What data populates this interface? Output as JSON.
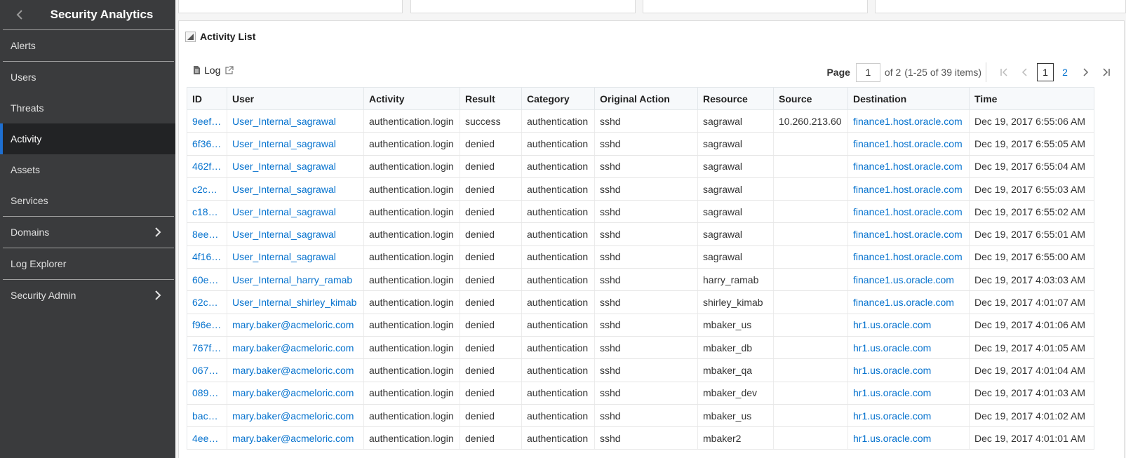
{
  "sidebar": {
    "title": "Security Analytics",
    "items": [
      {
        "label": "Alerts"
      },
      {
        "label": "Users"
      },
      {
        "label": "Threats"
      },
      {
        "label": "Activity"
      },
      {
        "label": "Assets"
      },
      {
        "label": "Services"
      },
      {
        "label": "Domains"
      },
      {
        "label": "Log Explorer"
      },
      {
        "label": "Security Admin"
      }
    ],
    "active": "Activity"
  },
  "panel": {
    "title": "Activity List",
    "log_label": "Log"
  },
  "pager": {
    "page_label": "Page",
    "current_page": "1",
    "of_text": "of 2",
    "range_text": "(1-25 of 39 items)",
    "pages": [
      "1",
      "2"
    ]
  },
  "table": {
    "columns": [
      "ID",
      "User",
      "Activity",
      "Result",
      "Category",
      "Original Action",
      "Resource",
      "Source",
      "Destination",
      "Time"
    ],
    "rows": [
      [
        "9eef…",
        "User_Internal_sagrawal",
        "authentication.login",
        "success",
        "authentication",
        "sshd",
        "sagrawal",
        "10.260.213.60",
        "finance1.host.oracle.com",
        "Dec 19, 2017 6:55:06 AM"
      ],
      [
        "6f36…",
        "User_Internal_sagrawal",
        "authentication.login",
        "denied",
        "authentication",
        "sshd",
        "sagrawal",
        "",
        "finance1.host.oracle.com",
        "Dec 19, 2017 6:55:05 AM"
      ],
      [
        "462f…",
        "User_Internal_sagrawal",
        "authentication.login",
        "denied",
        "authentication",
        "sshd",
        "sagrawal",
        "",
        "finance1.host.oracle.com",
        "Dec 19, 2017 6:55:04 AM"
      ],
      [
        "c2c…",
        "User_Internal_sagrawal",
        "authentication.login",
        "denied",
        "authentication",
        "sshd",
        "sagrawal",
        "",
        "finance1.host.oracle.com",
        "Dec 19, 2017 6:55:03 AM"
      ],
      [
        "c18…",
        "User_Internal_sagrawal",
        "authentication.login",
        "denied",
        "authentication",
        "sshd",
        "sagrawal",
        "",
        "finance1.host.oracle.com",
        "Dec 19, 2017 6:55:02 AM"
      ],
      [
        "8ee…",
        "User_Internal_sagrawal",
        "authentication.login",
        "denied",
        "authentication",
        "sshd",
        "sagrawal",
        "",
        "finance1.host.oracle.com",
        "Dec 19, 2017 6:55:01 AM"
      ],
      [
        "4f16…",
        "User_Internal_sagrawal",
        "authentication.login",
        "denied",
        "authentication",
        "sshd",
        "sagrawal",
        "",
        "finance1.host.oracle.com",
        "Dec 19, 2017 6:55:00 AM"
      ],
      [
        "60e…",
        "User_Internal_harry_ramab",
        "authentication.login",
        "denied",
        "authentication",
        "sshd",
        "harry_ramab",
        "",
        "finance1.us.oracle.com",
        "Dec 19, 2017 4:03:03 AM"
      ],
      [
        "62c…",
        "User_Internal_shirley_kimab",
        "authentication.login",
        "denied",
        "authentication",
        "sshd",
        "shirley_kimab",
        "",
        "finance1.us.oracle.com",
        "Dec 19, 2017 4:01:07 AM"
      ],
      [
        "f96e…",
        "mary.baker@acmeloric.com",
        "authentication.login",
        "denied",
        "authentication",
        "sshd",
        "mbaker_us",
        "",
        "hr1.us.oracle.com",
        "Dec 19, 2017 4:01:06 AM"
      ],
      [
        "767f…",
        "mary.baker@acmeloric.com",
        "authentication.login",
        "denied",
        "authentication",
        "sshd",
        "mbaker_db",
        "",
        "hr1.us.oracle.com",
        "Dec 19, 2017 4:01:05 AM"
      ],
      [
        "067…",
        "mary.baker@acmeloric.com",
        "authentication.login",
        "denied",
        "authentication",
        "sshd",
        "mbaker_qa",
        "",
        "hr1.us.oracle.com",
        "Dec 19, 2017 4:01:04 AM"
      ],
      [
        "089…",
        "mary.baker@acmeloric.com",
        "authentication.login",
        "denied",
        "authentication",
        "sshd",
        "mbaker_dev",
        "",
        "hr1.us.oracle.com",
        "Dec 19, 2017 4:01:03 AM"
      ],
      [
        "bac…",
        "mary.baker@acmeloric.com",
        "authentication.login",
        "denied",
        "authentication",
        "sshd",
        "mbaker_us",
        "",
        "hr1.us.oracle.com",
        "Dec 19, 2017 4:01:02 AM"
      ],
      [
        "4ee…",
        "mary.baker@acmeloric.com",
        "authentication.login",
        "denied",
        "authentication",
        "sshd",
        "mbaker2",
        "",
        "hr1.us.oracle.com",
        "Dec 19, 2017 4:01:01 AM"
      ]
    ]
  },
  "colors": {
    "sidebar_bg": "#3a3b3d",
    "active_bg": "#222325",
    "accent": "#1e6fd1",
    "link": "#0572ce"
  }
}
